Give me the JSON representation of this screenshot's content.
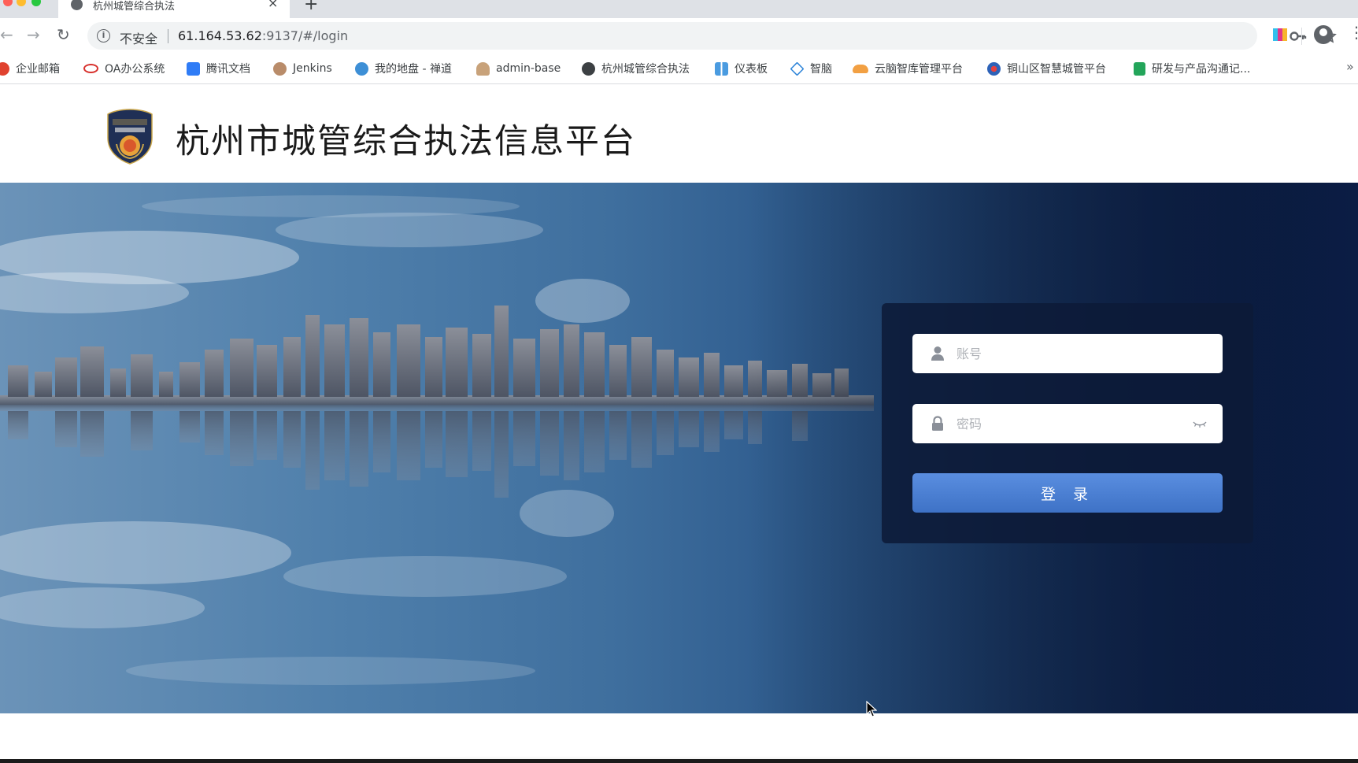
{
  "browser": {
    "tab": {
      "title": "杭州城管综合执法",
      "close": "×",
      "new_tab": "+"
    },
    "toolbar": {
      "security_label": "不安全",
      "url_host": "61.164.53.62",
      "url_path": ":9137/#/login"
    },
    "bookmarks": [
      {
        "label": "企业邮箱",
        "icon": "mail-icon",
        "color": "#e0422f"
      },
      {
        "label": "OA办公系统",
        "icon": "oa-icon",
        "color": "#d8322e"
      },
      {
        "label": "腾讯文档",
        "icon": "tencent-docs-icon",
        "color": "#2f7cf6"
      },
      {
        "label": "Jenkins",
        "icon": "jenkins-icon",
        "color": "#b98c6a"
      },
      {
        "label": "我的地盘 - 禅道",
        "icon": "zentao-icon",
        "color": "#3d8fd6"
      },
      {
        "label": "admin-base",
        "icon": "admin-icon",
        "color": "#c8a27a"
      },
      {
        "label": "杭州城管综合执法",
        "icon": "globe-icon",
        "color": "#3c4043"
      },
      {
        "label": "仪表板",
        "icon": "dashboard-icon",
        "color": "#4a9be0"
      },
      {
        "label": "智脑",
        "icon": "diamond-icon",
        "color": "#2b83d8"
      },
      {
        "label": "云脑智库管理平台",
        "icon": "cloud-icon",
        "color": "#f2a043"
      },
      {
        "label": "铜山区智慧城管平台",
        "icon": "badge-icon",
        "color": "#2d62b8"
      },
      {
        "label": "研发与产品沟通记...",
        "icon": "sheet-icon",
        "color": "#23a55a"
      }
    ],
    "more": "»"
  },
  "page": {
    "title": "杭州市城管综合执法信息平台"
  },
  "login": {
    "account_placeholder": "账号",
    "password_placeholder": "密码",
    "submit_label": "登 录"
  }
}
